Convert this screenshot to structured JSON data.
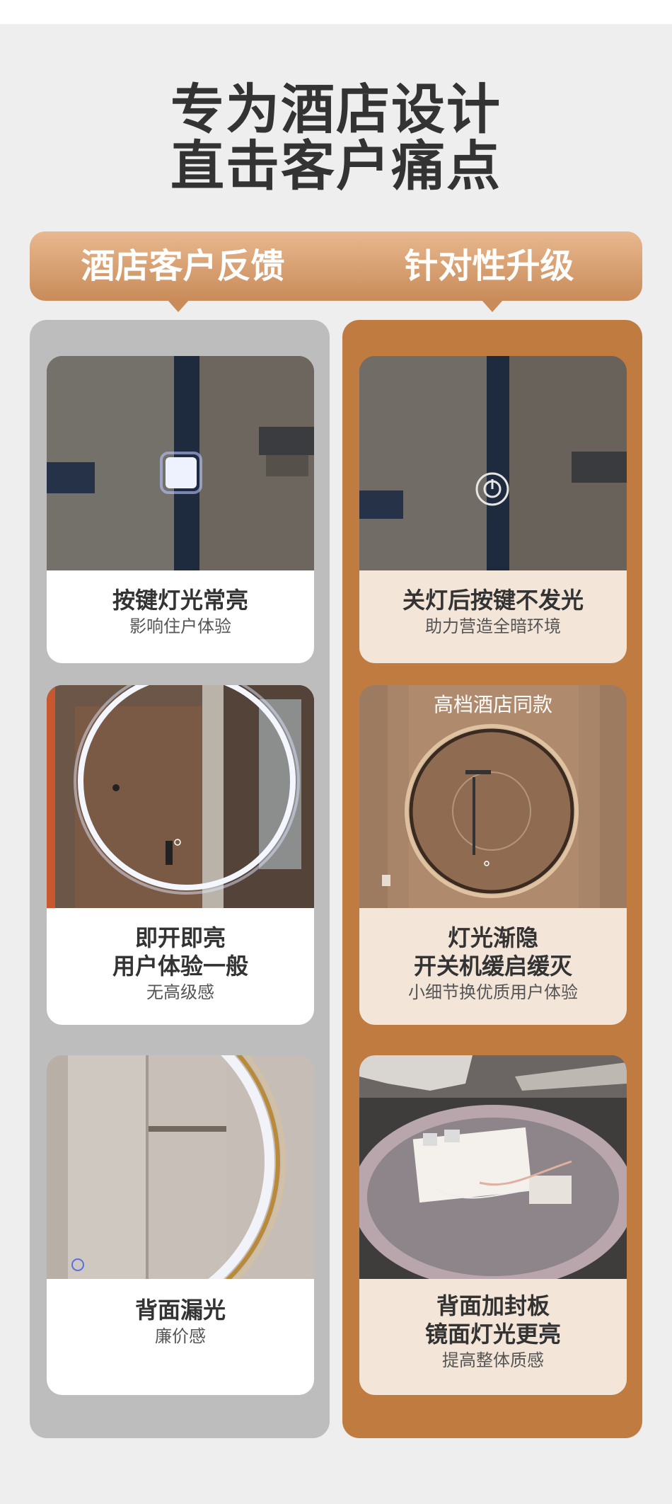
{
  "title": {
    "line1": "专为酒店设计",
    "line2": "直击客户痛点"
  },
  "header": {
    "left_label": "酒店客户反馈",
    "right_label": "针对性升级"
  },
  "feedback": [
    {
      "headline": [
        "按键灯光常亮"
      ],
      "sub": "影响住户体验"
    },
    {
      "headline": [
        "即开即亮",
        "用户体验一般"
      ],
      "sub": "无高级感"
    },
    {
      "headline": [
        "背面漏光"
      ],
      "sub": "廉价感"
    }
  ],
  "upgrades": [
    {
      "headline": [
        "关灯后按键不发光"
      ],
      "sub": "助力营造全暗环境"
    },
    {
      "headline": [
        "灯光渐隐",
        "开关机缓启缓灭"
      ],
      "sub": "小细节换优质用户体验",
      "photo_badge": "高档酒店同款"
    },
    {
      "headline": [
        "背面加封板",
        "镜面灯光更亮"
      ],
      "sub": "提高整体质感"
    }
  ],
  "colors": {
    "accent": "#c07c40",
    "gray_column": "#bdbdbd",
    "header_gradient_top": "#e8b88f",
    "header_gradient_bottom": "#c98b59"
  }
}
